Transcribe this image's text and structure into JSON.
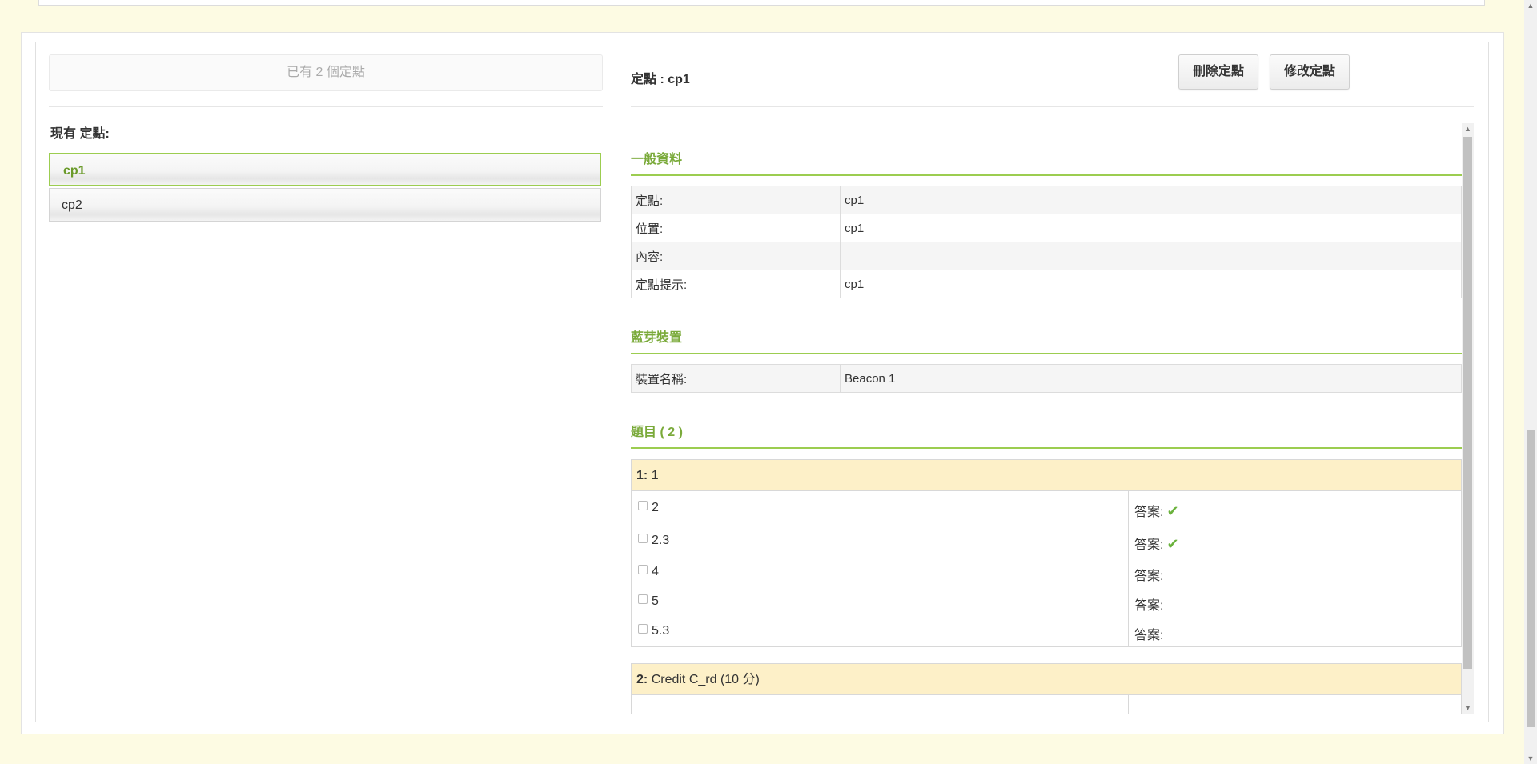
{
  "left_panel": {
    "count_text": "已有 2 個定點",
    "list_title": "現有 定點:",
    "items": [
      {
        "label": "cp1",
        "active": true
      },
      {
        "label": "cp2",
        "active": false
      }
    ]
  },
  "right_panel": {
    "title": "定點 : cp1",
    "delete_button": "刪除定點",
    "edit_button": "修改定點",
    "general": {
      "title": "一般資料",
      "rows": [
        {
          "key": "定點:",
          "value": "cp1"
        },
        {
          "key": "位置:",
          "value": "cp1"
        },
        {
          "key": "內容:",
          "value": ""
        },
        {
          "key": "定點提示:",
          "value": "cp1"
        }
      ]
    },
    "bluetooth": {
      "title": "藍芽裝置",
      "rows": [
        {
          "key": "裝置名稱:",
          "value": "Beacon 1"
        }
      ]
    },
    "questions": {
      "title": "題目 ( 2 )",
      "items": [
        {
          "number": "1:",
          "text": "1",
          "options": [
            {
              "label": "2",
              "answer_label": "答案:",
              "correct": true
            },
            {
              "label": "2.3",
              "answer_label": "答案:",
              "correct": true
            },
            {
              "label": "4",
              "answer_label": "答案:",
              "correct": false
            },
            {
              "label": "5",
              "answer_label": "答案:",
              "correct": false
            },
            {
              "label": "5.3",
              "answer_label": "答案:",
              "correct": false
            }
          ]
        },
        {
          "number": "2:",
          "text": "Credit C_rd (10 分)"
        }
      ]
    }
  },
  "icons": {
    "checkmark": "✔",
    "scroll_up": "▲",
    "scroll_down": "▼"
  },
  "colors": {
    "accent": "#9ccd50",
    "section_title": "#7aaa3a",
    "question_header": "#fdf0c8",
    "page_background": "#fdfbe3"
  }
}
